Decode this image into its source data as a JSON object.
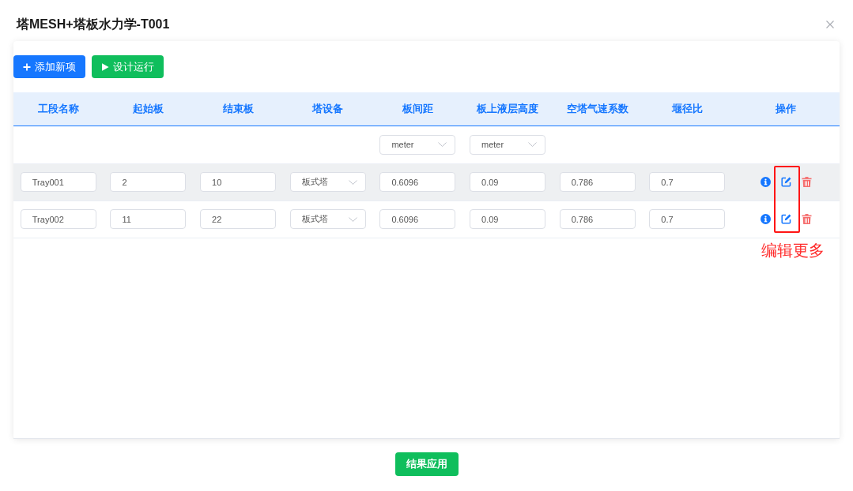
{
  "dialog": {
    "title": "塔MESH+塔板水力学-T001"
  },
  "toolbar": [
    {
      "kind": "add",
      "label": "添加新项"
    },
    {
      "kind": "run",
      "label": "设计运行"
    }
  ],
  "table": {
    "columns": [
      {
        "label": "工段名称",
        "kind": "text"
      },
      {
        "label": "起始板",
        "kind": "text"
      },
      {
        "label": "结束板",
        "kind": "text"
      },
      {
        "label": "塔设备",
        "kind": "select"
      },
      {
        "label": "板间距",
        "kind": "text",
        "unit": "meter"
      },
      {
        "label": "板上液层高度",
        "kind": "text",
        "unit": "meter"
      },
      {
        "label": "空塔气速系数",
        "kind": "text"
      },
      {
        "label": "堰径比",
        "kind": "text"
      },
      {
        "label": "操作",
        "kind": "actions"
      }
    ],
    "rows": [
      {
        "hovered": true,
        "cells": [
          "Tray001",
          "2",
          "10",
          "板式塔",
          "0.6096",
          "0.09",
          "0.786",
          "0.7"
        ]
      },
      {
        "hovered": false,
        "cells": [
          "Tray002",
          "11",
          "22",
          "板式塔",
          "0.6096",
          "0.09",
          "0.786",
          "0.7"
        ]
      }
    ]
  },
  "annotation": {
    "kind": "callout",
    "text": "编辑更多"
  },
  "footer": {
    "button": "结果应用"
  }
}
